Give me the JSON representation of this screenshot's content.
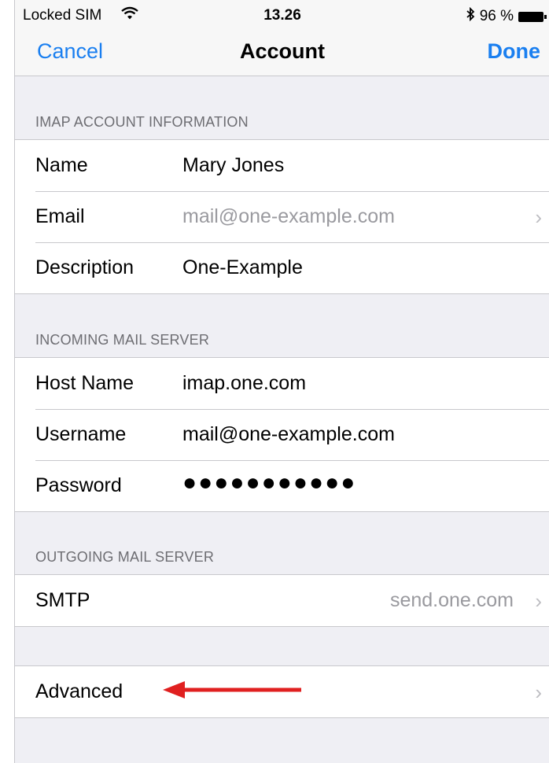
{
  "status_bar": {
    "carrier": "Locked SIM",
    "time": "13.26",
    "battery": "96 %"
  },
  "nav": {
    "cancel": "Cancel",
    "title": "Account",
    "done": "Done"
  },
  "sections": {
    "imap": {
      "header": "IMAP ACCOUNT INFORMATION",
      "name": {
        "label": "Name",
        "value": "Mary Jones"
      },
      "email": {
        "label": "Email",
        "value": "mail@one-example.com"
      },
      "description": {
        "label": "Description",
        "value": "One-Example"
      }
    },
    "incoming": {
      "header": "INCOMING MAIL SERVER",
      "host": {
        "label": "Host Name",
        "value": "imap.one.com"
      },
      "username": {
        "label": "Username",
        "value": "mail@one-example.com"
      },
      "password": {
        "label": "Password",
        "value": "●●●●●●●●●●●"
      }
    },
    "outgoing": {
      "header": "OUTGOING MAIL SERVER",
      "smtp": {
        "label": "SMTP",
        "value": "send.one.com"
      }
    },
    "advanced": {
      "label": "Advanced"
    }
  },
  "icons": {
    "wifi": "wifi-icon",
    "bluetooth": "bluetooth-icon",
    "battery": "battery-icon",
    "chevron": "chevron-right-icon",
    "arrow": "red-arrow-annotation"
  },
  "colors": {
    "accent": "#1a7ff0",
    "annotation": "#e02020"
  }
}
